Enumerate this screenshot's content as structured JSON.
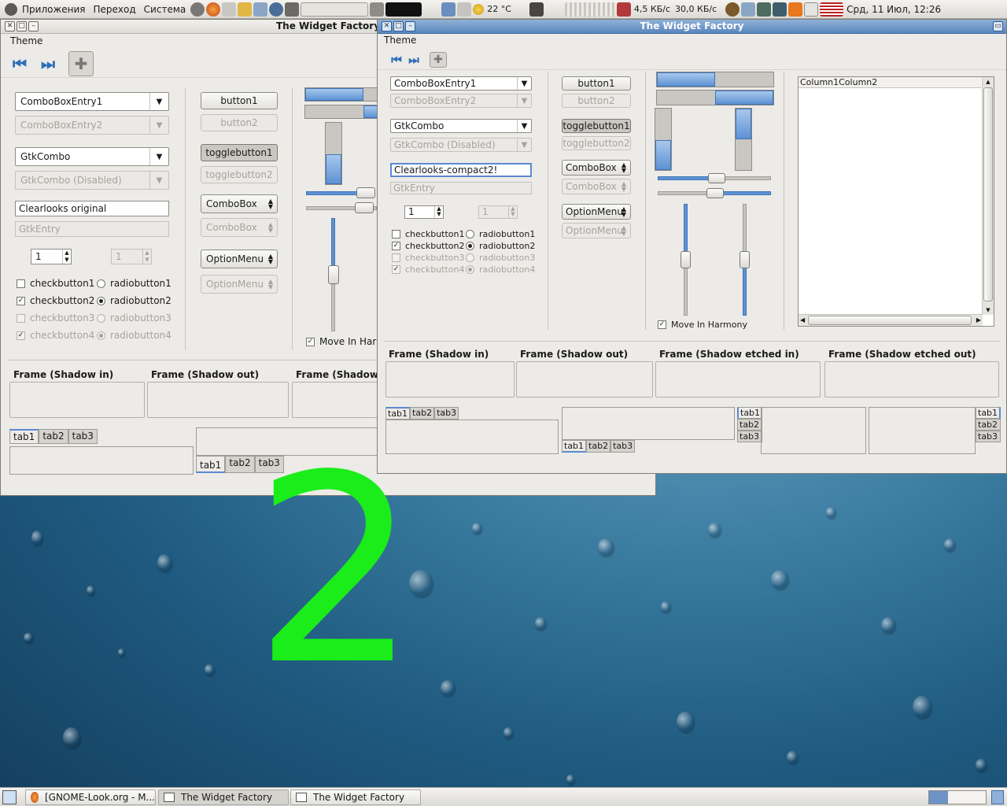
{
  "panel": {
    "menus": [
      "Приложения",
      "Переход",
      "Система"
    ],
    "weather": "22 °C",
    "net_down": "4,5 КБ/с",
    "net_up": "30,0 КБ/с",
    "clock": "Срд, 11 Июл, 12:26"
  },
  "back_window": {
    "title": "The Widget Factory",
    "menu": "Theme",
    "combo_entry1": "ComboBoxEntry1",
    "combo_entry2": "ComboBoxEntry2",
    "gtk_combo": "GtkCombo",
    "gtk_combo_disabled": "GtkCombo (Disabled)",
    "entry_value": "Clearlooks original",
    "entry_placeholder": "GtkEntry",
    "spin1": "1",
    "spin2": "1",
    "checkbuttons": [
      "checkbutton1",
      "checkbutton2",
      "checkbutton3",
      "checkbutton4"
    ],
    "radiobuttons": [
      "radiobutton1",
      "radiobutton2",
      "radiobutton3",
      "radiobutton4"
    ],
    "button1": "button1",
    "button2": "button2",
    "togglebutton1": "togglebutton1",
    "togglebutton2": "togglebutton2",
    "combobox1": "ComboBox",
    "combobox2": "ComboBox",
    "optionmenu1": "OptionMenu",
    "optionmenu2": "OptionMenu",
    "move_in_harmony": "Move In Harr",
    "frames": [
      "Frame (Shadow in)",
      "Frame (Shadow out)",
      "Frame (Shadow"
    ],
    "tabs": [
      "tab1",
      "tab2",
      "tab3"
    ]
  },
  "front_window": {
    "title": "The Widget Factory",
    "menu": "Theme",
    "combo_entry1": "ComboBoxEntry1",
    "combo_entry2": "ComboBoxEntry2",
    "gtk_combo": "GtkCombo",
    "gtk_combo_disabled": "GtkCombo (Disabled)",
    "entry_value": "Clearlooks-compact2!",
    "entry_placeholder": "GtkEntry",
    "spin1": "1",
    "spin2": "1",
    "checkbuttons": [
      "checkbutton1",
      "checkbutton2",
      "checkbutton3",
      "checkbutton4"
    ],
    "radiobuttons": [
      "radiobutton1",
      "radiobutton2",
      "radiobutton3",
      "radiobutton4"
    ],
    "button1": "button1",
    "button2": "button2",
    "togglebutton1": "togglebutton1",
    "togglebutton2": "togglebutton2",
    "combobox1": "ComboBox",
    "combobox2": "ComboBox",
    "optionmenu1": "OptionMenu",
    "optionmenu2": "OptionMenu",
    "move_in_harmony": "Move In Harmony",
    "tree_columns": "Column1Column2",
    "frames": [
      "Frame (Shadow in)",
      "Frame (Shadow out)",
      "Frame (Shadow etched in)",
      "Frame (Shadow etched out)"
    ],
    "tabs": [
      "tab1",
      "tab2",
      "tab3"
    ]
  },
  "overlay_number": "2",
  "taskbar": {
    "items": [
      "[GNOME-Look.org - M...",
      "The Widget Factory",
      "The Widget Factory"
    ]
  },
  "colors": {
    "accent": "#5d92d4",
    "overlay_green": "#1aed1a"
  }
}
